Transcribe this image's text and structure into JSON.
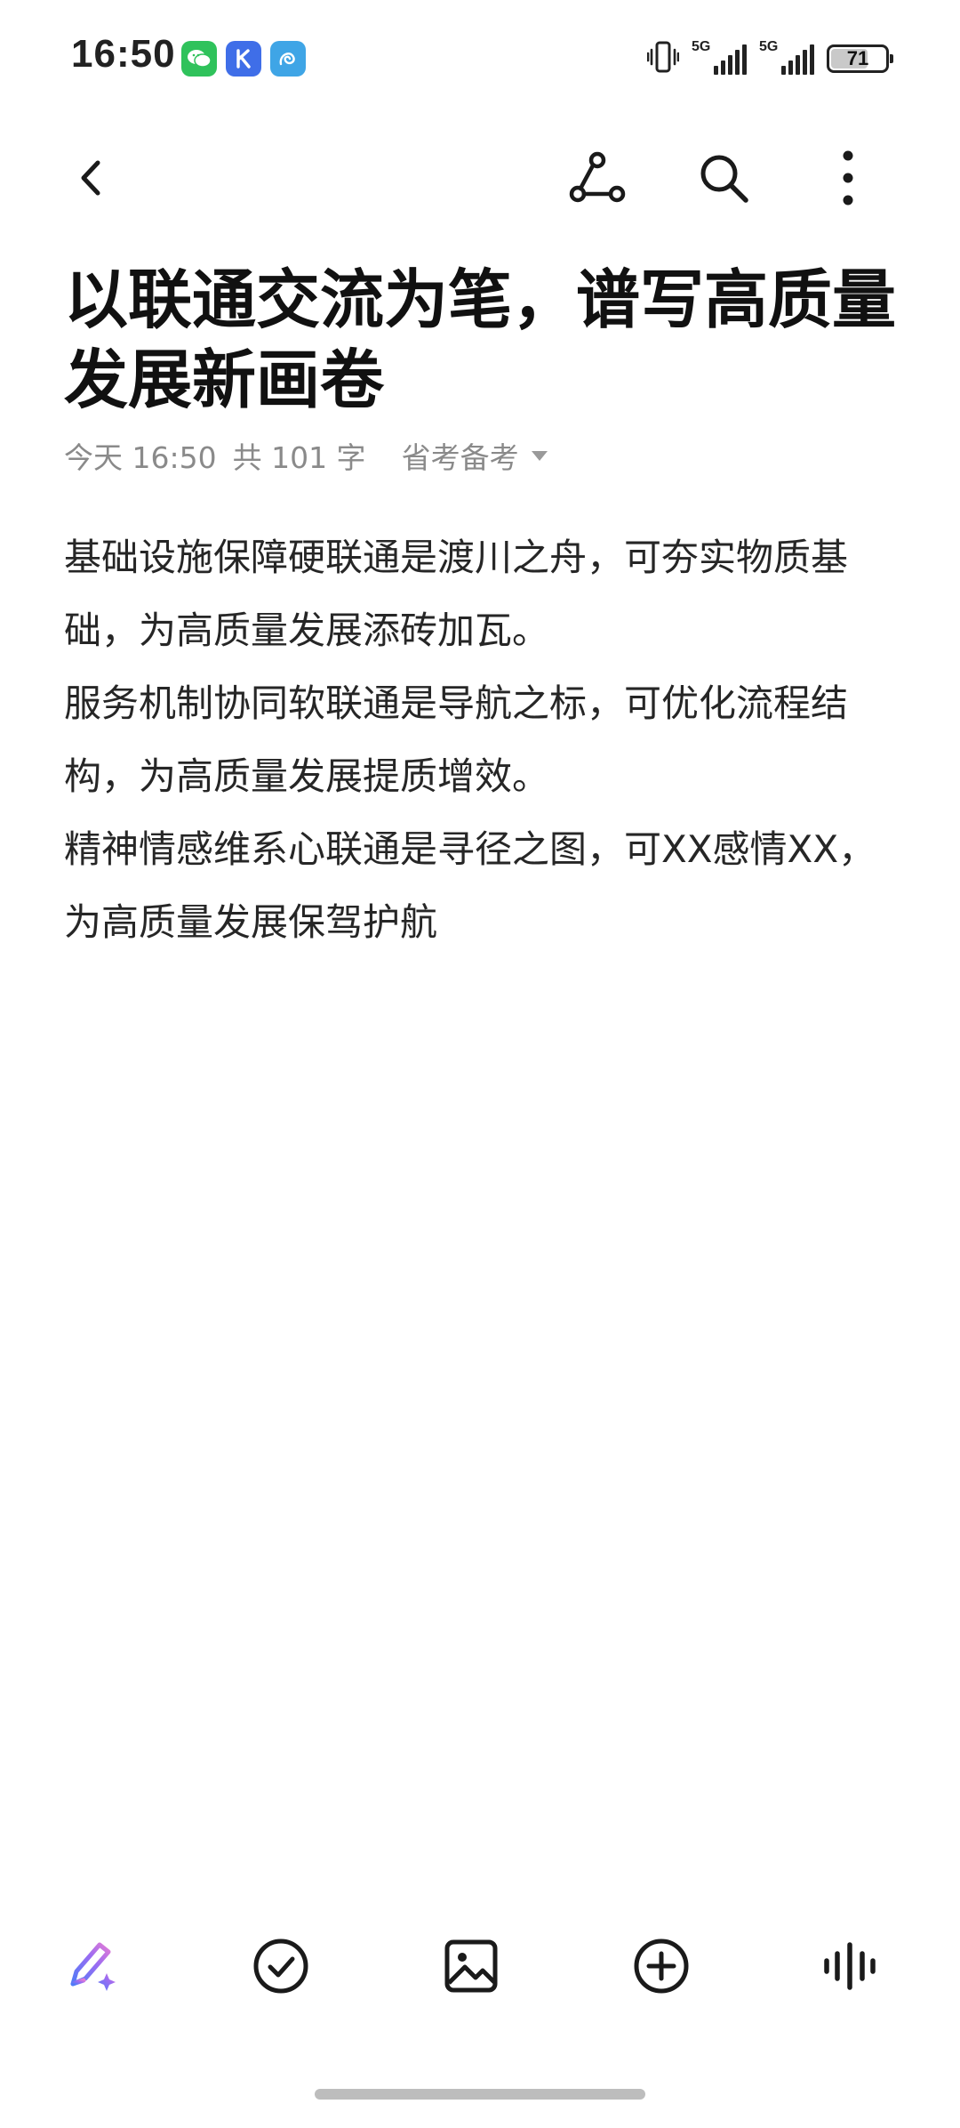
{
  "status_bar": {
    "time": "16:50",
    "app_icons": [
      "wechat-icon",
      "k-app-icon",
      "swirl-app-icon"
    ],
    "signal_1": {
      "network": "5G"
    },
    "signal_2": {
      "network": "5G"
    },
    "battery_level": "71"
  },
  "toolbar": {
    "back_icon": "chevron-left-icon",
    "share_icon": "share-graph-icon",
    "search_icon": "search-icon",
    "more_icon": "more-vertical-icon"
  },
  "note": {
    "title": "以联通交流为笔，谱写高质量发展新画卷",
    "date": "今天 16:50",
    "word_count": "共 101 字",
    "folder": "省考备考",
    "paragraphs": [
      "基础设施保障硬联通是渡川之舟，可夯实物质基础，为高质量发展添砖加瓦。",
      "服务机制协同软联通是导航之标，可优化流程结构，为高质量发展提质增效。",
      "精神情感维系心联通是寻径之图，可XX感情XX，为高质量发展保驾护航"
    ]
  },
  "bottom_bar": {
    "tools": [
      "ai-pen-icon",
      "checklist-icon",
      "image-icon",
      "add-icon",
      "voice-icon"
    ]
  },
  "colors": {
    "background": "#ffffff",
    "text": "#262626",
    "meta_text": "#8a8a8a"
  }
}
